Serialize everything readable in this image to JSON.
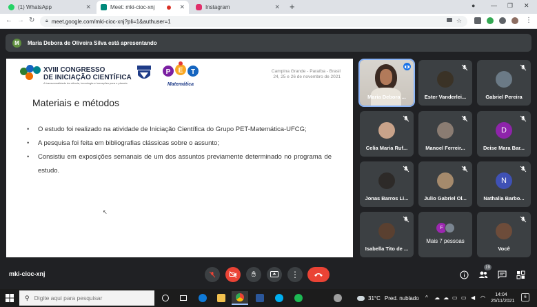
{
  "browser": {
    "tabs": [
      {
        "label": "(1) WhatsApp",
        "icon": "whatsapp-icon",
        "color": "#25d366"
      },
      {
        "label": "Meet: mki-cioc-xnj",
        "icon": "meet-icon",
        "color": "#00897b"
      },
      {
        "label": "Instagram",
        "icon": "instagram-icon",
        "color": "#e1306c"
      }
    ],
    "url": "meet.google.com/mki-cioc-xnj?pli=1&authuser=1"
  },
  "meet": {
    "presenter_banner": "Maria Debora de Oliveira Silva está apresentando",
    "presenter_initial": "M",
    "meeting_code": "mki-cioc-xnj",
    "participant_count": "19",
    "slide": {
      "congress_title_line1": "XVIII CONGRESSO",
      "congress_title_line2": "DE INICIAÇÃO CIENTÍFICA",
      "congress_sub": "A transversalidade da ciência, tecnologia e inovações para o planeta",
      "pet_word": "Matemática",
      "event_city": "Campina Grande - Paraíba - Brasil",
      "event_dates": "24, 25 e 26 de novembro de 2021",
      "title": "Materiais e métodos",
      "bullets": [
        "O estudo foi realizado na atividade de Iniciação Científica do Grupo PET-Matemática-UFCG;",
        "A pesquisa foi feita em bibliografias clássicas sobre o assunto;",
        "Consistiu em exposições semanais de um dos assuntos previamente determinado no programa de estudo."
      ]
    },
    "participants": [
      {
        "name": "Maria Debora ...",
        "type": "video",
        "speaking": true
      },
      {
        "name": "Ester Vanderlei...",
        "type": "photo",
        "color": "#3a3226"
      },
      {
        "name": "Gabriel Pereira",
        "type": "photo",
        "color": "#6b7a86"
      },
      {
        "name": "Celia Maria Ruf...",
        "type": "photo",
        "color": "#c9a38a"
      },
      {
        "name": "Manoel Ferreir...",
        "type": "photo",
        "color": "#8a7c72"
      },
      {
        "name": "Deise Mara Bar...",
        "type": "letter",
        "letter": "D",
        "color": "#8e24aa"
      },
      {
        "name": "Jonas Barros Li...",
        "type": "photo",
        "color": "#2d2a28"
      },
      {
        "name": "Julio Gabriel Ol...",
        "type": "photo",
        "color": "#a58a6c"
      },
      {
        "name": "Nathalia Barbo...",
        "type": "letter",
        "letter": "N",
        "color": "#3f51b5"
      },
      {
        "name": "Isabella Tito de ...",
        "type": "photo",
        "color": "#5a4030"
      },
      {
        "name": "Mais 7 pessoas",
        "type": "more",
        "letter": "F"
      },
      {
        "name": "Você",
        "type": "photo",
        "color": "#6d4c3a"
      }
    ]
  },
  "taskbar": {
    "search_placeholder": "Digite aqui para pesquisar",
    "temperature": "31°C",
    "weather": "Pred. nublado",
    "time": "14:04",
    "date": "25/11/2021",
    "notifications": "6"
  }
}
